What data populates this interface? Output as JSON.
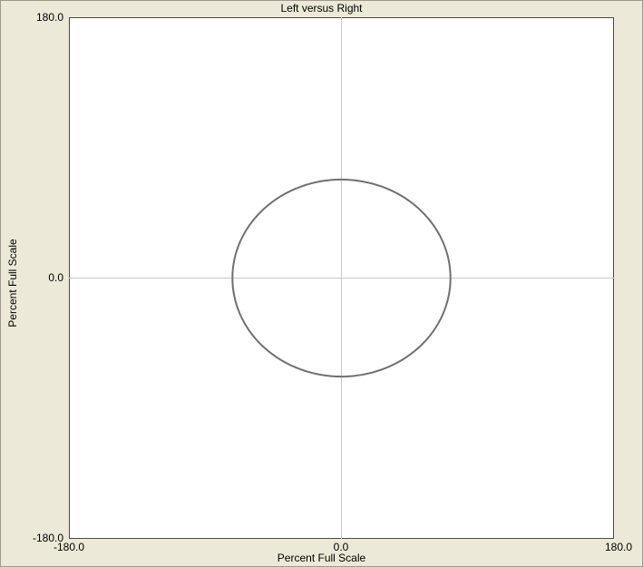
{
  "chart_data": {
    "type": "line",
    "title": "Left versus Right",
    "xlabel": "Percent Full Scale",
    "ylabel": "Percent Full Scale",
    "xlim": [
      -180.0,
      180.0
    ],
    "ylim": [
      -180.0,
      180.0
    ],
    "x_tick_labels": [
      "-180.0",
      "0.0",
      "180.0"
    ],
    "y_tick_labels": [
      "180.0",
      "0.0",
      "-180.0"
    ],
    "x_ticks": [
      -180.0,
      0.0,
      180.0
    ],
    "y_ticks": [
      180.0,
      0.0,
      -180.0
    ],
    "grid": false,
    "zero_lines": true,
    "series": [
      {
        "shape": "ellipse",
        "center": [
          0.0,
          0.0
        ],
        "radius_x": 72.0,
        "radius_y": 68.0,
        "color": "#707070"
      }
    ]
  },
  "colors": {
    "background": "#ece9d8",
    "plot_background": "#ffffff",
    "axis_line": "#c8c8c8",
    "curve": "#707070"
  }
}
